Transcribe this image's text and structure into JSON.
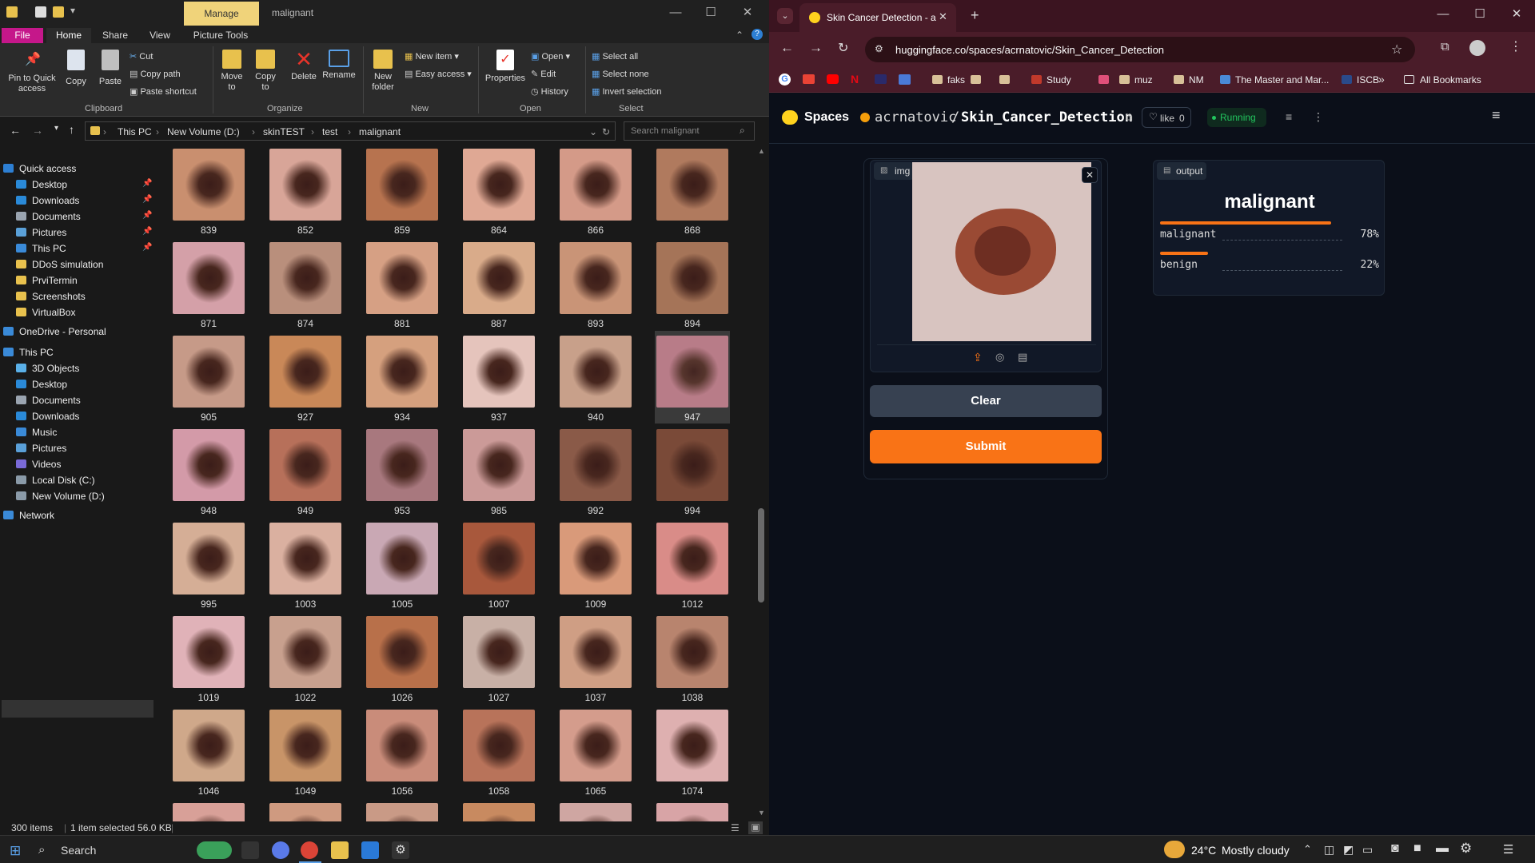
{
  "explorer": {
    "window_title": "malignant",
    "manage_tab": "Manage",
    "tabs": [
      "File",
      "Home",
      "Share",
      "View",
      "Picture Tools"
    ],
    "ribbon": {
      "pin": "Pin to Quick access",
      "copy": "Copy",
      "paste": "Paste",
      "cut": "Cut",
      "copy_path": "Copy path",
      "paste_shortcut": "Paste shortcut",
      "move_to": "Move to",
      "copy_to": "Copy to",
      "delete": "Delete",
      "rename": "Rename",
      "new_folder": "New folder",
      "new_item": "New item",
      "easy_access": "Easy access",
      "properties": "Properties",
      "open": "Open",
      "edit": "Edit",
      "history": "History",
      "select_all": "Select all",
      "select_none": "Select none",
      "invert_selection": "Invert selection",
      "groups": [
        "Clipboard",
        "Organize",
        "New",
        "Open",
        "Select"
      ]
    },
    "breadcrumb": [
      "This PC",
      "New Volume (D:)",
      "skinTEST",
      "test",
      "malignant"
    ],
    "search_placeholder": "Search malignant",
    "nav": [
      {
        "label": "Quick access",
        "icon": "star-icon",
        "color": "#2d7fd3",
        "indent": 0,
        "pinned": false
      },
      {
        "label": "Desktop",
        "icon": "desktop-icon",
        "color": "#2a8ad8",
        "indent": 1,
        "pinned": true
      },
      {
        "label": "Downloads",
        "icon": "download-icon",
        "color": "#2a8ad8",
        "indent": 1,
        "pinned": true
      },
      {
        "label": "Documents",
        "icon": "documents-icon",
        "color": "#9aa4b0",
        "indent": 1,
        "pinned": true
      },
      {
        "label": "Pictures",
        "icon": "pictures-icon",
        "color": "#5aa0d8",
        "indent": 1,
        "pinned": true
      },
      {
        "label": "This PC",
        "icon": "pc-icon",
        "color": "#3a8ad8",
        "indent": 1,
        "pinned": true
      },
      {
        "label": "DDoS simulation",
        "icon": "folder-icon",
        "color": "#e8c14d",
        "indent": 1,
        "pinned": false
      },
      {
        "label": "PrviTermin",
        "icon": "folder-icon",
        "color": "#e8c14d",
        "indent": 1,
        "pinned": false
      },
      {
        "label": "Screenshots",
        "icon": "folder-icon",
        "color": "#e8c14d",
        "indent": 1,
        "pinned": false
      },
      {
        "label": "VirtualBox",
        "icon": "folder-icon",
        "color": "#e8c14d",
        "indent": 1,
        "pinned": false
      },
      {
        "label": "OneDrive - Personal",
        "icon": "cloud-icon",
        "color": "#3a8ad8",
        "indent": 0,
        "pinned": false
      },
      {
        "label": "This PC",
        "icon": "pc-icon",
        "color": "#3a8ad8",
        "indent": 0,
        "pinned": false
      },
      {
        "label": "3D Objects",
        "icon": "cube-icon",
        "color": "#5ab0e8",
        "indent": 1,
        "pinned": false
      },
      {
        "label": "Desktop",
        "icon": "desktop-icon",
        "color": "#2a8ad8",
        "indent": 1,
        "pinned": false
      },
      {
        "label": "Documents",
        "icon": "documents-icon",
        "color": "#9aa4b0",
        "indent": 1,
        "pinned": false
      },
      {
        "label": "Downloads",
        "icon": "download-icon",
        "color": "#2a8ad8",
        "indent": 1,
        "pinned": false
      },
      {
        "label": "Music",
        "icon": "music-icon",
        "color": "#3a8ad8",
        "indent": 1,
        "pinned": false
      },
      {
        "label": "Pictures",
        "icon": "pictures-icon",
        "color": "#5aa0d8",
        "indent": 1,
        "pinned": false
      },
      {
        "label": "Videos",
        "icon": "videos-icon",
        "color": "#7a6ad8",
        "indent": 1,
        "pinned": false
      },
      {
        "label": "Local Disk (C:)",
        "icon": "drive-icon",
        "color": "#8a9aa8",
        "indent": 1,
        "pinned": false
      },
      {
        "label": "New Volume (D:)",
        "icon": "drive-icon",
        "color": "#8a9aa8",
        "indent": 1,
        "pinned": false
      },
      {
        "label": "Network",
        "icon": "network-icon",
        "color": "#3a8ad8",
        "indent": 0,
        "pinned": false
      }
    ],
    "files": [
      {
        "name": "839",
        "color": "#c98f6f"
      },
      {
        "name": "852",
        "color": "#d8a598"
      },
      {
        "name": "859",
        "color": "#b7734f"
      },
      {
        "name": "864",
        "color": "#dfa894"
      },
      {
        "name": "866",
        "color": "#d49a88"
      },
      {
        "name": "868",
        "color": "#b07a5e"
      },
      {
        "name": "871",
        "color": "#d4a0a8"
      },
      {
        "name": "874",
        "color": "#b98f7c"
      },
      {
        "name": "881",
        "color": "#d6a084"
      },
      {
        "name": "887",
        "color": "#d9ab8a"
      },
      {
        "name": "893",
        "color": "#c99477"
      },
      {
        "name": "894",
        "color": "#a57458"
      },
      {
        "name": "905",
        "color": "#c69a88"
      },
      {
        "name": "927",
        "color": "#c98858"
      },
      {
        "name": "934",
        "color": "#d5a07e"
      },
      {
        "name": "937",
        "color": "#e5c4bc"
      },
      {
        "name": "940",
        "color": "#c8a08a"
      },
      {
        "name": "947",
        "color": "#b87c88"
      },
      {
        "name": "948",
        "color": "#d39aa8"
      },
      {
        "name": "949",
        "color": "#b7705a"
      },
      {
        "name": "953",
        "color": "#a8787e"
      },
      {
        "name": "985",
        "color": "#cb9a98"
      },
      {
        "name": "992",
        "color": "#8a5a48"
      },
      {
        "name": "994",
        "color": "#7a4a38"
      },
      {
        "name": "995",
        "color": "#d5ae96"
      },
      {
        "name": "1003",
        "color": "#dab0a0"
      },
      {
        "name": "1005",
        "color": "#c9a8b4"
      },
      {
        "name": "1007",
        "color": "#a8583c"
      },
      {
        "name": "1009",
        "color": "#d99a7a"
      },
      {
        "name": "1012",
        "color": "#d98c88"
      },
      {
        "name": "1019",
        "color": "#e0b2b8"
      },
      {
        "name": "1022",
        "color": "#c8a08e"
      },
      {
        "name": "1026",
        "color": "#b8704a"
      },
      {
        "name": "1027",
        "color": "#c8b0a6"
      },
      {
        "name": "1037",
        "color": "#cf9e84"
      },
      {
        "name": "1038",
        "color": "#b8846e"
      },
      {
        "name": "1046",
        "color": "#cfa88a"
      },
      {
        "name": "1049",
        "color": "#c89468"
      },
      {
        "name": "1056",
        "color": "#c98c7a"
      },
      {
        "name": "1058",
        "color": "#b8735a"
      },
      {
        "name": "1065",
        "color": "#d49c8c"
      },
      {
        "name": "1074",
        "color": "#deb0b0"
      },
      {
        "name": "",
        "color": "#d8a098"
      },
      {
        "name": "",
        "color": "#cf9a80"
      },
      {
        "name": "",
        "color": "#c99a86"
      },
      {
        "name": "",
        "color": "#c88a60"
      },
      {
        "name": "",
        "color": "#cfa6a2"
      },
      {
        "name": "",
        "color": "#d8a4a6"
      }
    ],
    "selected_index": 17,
    "status": {
      "count": "300 items",
      "selection": "1 item selected  56.0 KB"
    }
  },
  "browser": {
    "tab_title": "Skin Cancer Detection - a Hugg",
    "url": "huggingface.co/spaces/acrnatovic/Skin_Cancer_Detection",
    "bookmarks": [
      {
        "label": "faks",
        "color": "#d8c098"
      },
      {
        "label": "",
        "color": "#d8c098"
      },
      {
        "label": "",
        "color": "#d8c098"
      },
      {
        "label": "Study",
        "color": "#c0392b"
      },
      {
        "label": "",
        "color": "#e0507a"
      },
      {
        "label": "muz",
        "color": "#d8c098"
      },
      {
        "label": "NM",
        "color": "#d8c098"
      },
      {
        "label": "The Master and Mar...",
        "color": "#4a8ad8"
      },
      {
        "label": "ISCB",
        "color": "#2a4a8a"
      }
    ],
    "all_bookmarks": "All Bookmarks",
    "hf": {
      "spaces": "Spaces",
      "owner": "acrnatovic",
      "repo": "Skin_Cancer_Detection",
      "like": "like",
      "likes": "0",
      "status": "Running",
      "input_label": "img",
      "output_label": "output",
      "prediction": "malignant",
      "confidences": [
        {
          "label": "malignant",
          "pct": "78%",
          "value": 0.78
        },
        {
          "label": "benign",
          "pct": "22%",
          "value": 0.22
        }
      ],
      "clear": "Clear",
      "submit": "Submit",
      "accent": "#f97316"
    }
  },
  "taskbar": {
    "search": "Search",
    "temp": "24°C",
    "weather": "Mostly cloudy"
  }
}
